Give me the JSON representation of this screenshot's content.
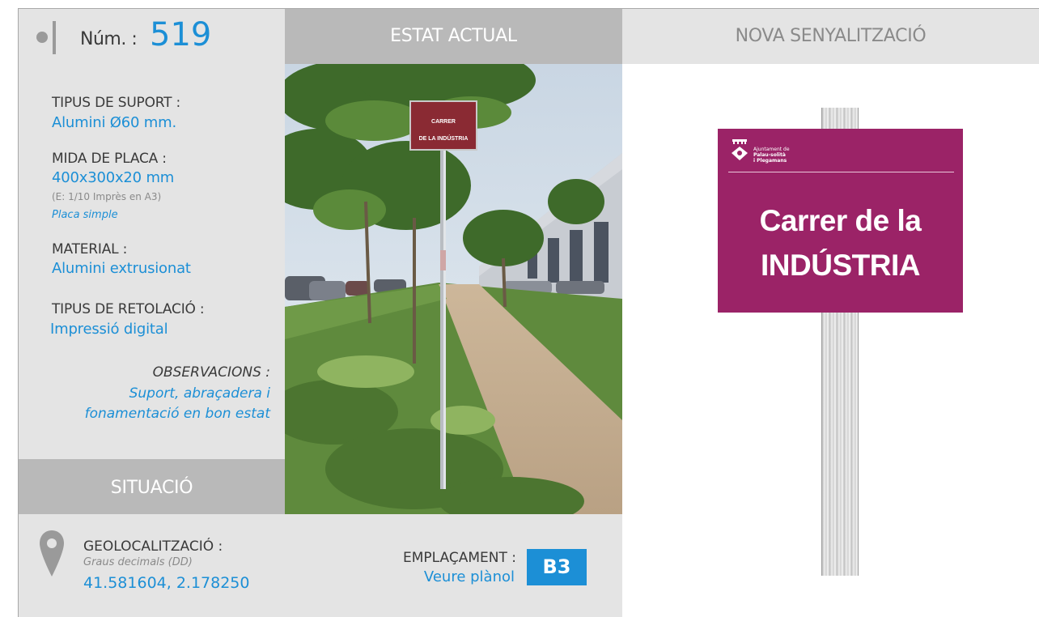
{
  "header": {
    "num_label": "Núm. :",
    "num_value": "519",
    "estat_actual": "ESTAT ACTUAL",
    "nova_senyalitzacio": "NOVA SENYALITZACIÓ"
  },
  "info": {
    "tipus_suport_label": "TIPUS DE SUPORT :",
    "tipus_suport_value": "Alumini Ø60 mm.",
    "mida_placa_label": "MIDA DE PLACA :",
    "mida_placa_value": "400x300x20 mm",
    "mida_placa_escala": "(E: 1/10 Imprès en A3)",
    "mida_placa_tipus": "Placa simple",
    "material_label": "MATERIAL :",
    "material_value": "Alumini extrusionat",
    "retolacio_label": "TIPUS DE RETOLACIÓ :",
    "retolacio_value": "Impressió digital",
    "observacions_label": "OBSERVACIONS :",
    "observacions_line1": "Suport, abraçadera i",
    "observacions_line2": "fonamentació en bon estat"
  },
  "situacio": {
    "title": "SITUACIÓ",
    "geo_label": "GEOLOCALITZACIÓ :",
    "geo_format": "Graus decimals (DD)",
    "geo_value": "41.581604, 2.178250",
    "emplacament_label": "EMPLAÇAMENT :",
    "emplacament_value": "Veure plànol",
    "emplacament_code": "B3"
  },
  "photo_sign": {
    "line1": "CARRER",
    "line2": "DE LA INDÚSTRIA"
  },
  "new_sign": {
    "ajuntament_line1": "Ajuntament de",
    "ajuntament_line2": "Palau-solità",
    "ajuntament_line3": "i Plegamans",
    "title_line1": "Carrer de la",
    "title_line2": "INDÚSTRIA"
  },
  "colors": {
    "accent_blue": "#1c8fd6",
    "panel_grey": "#e4e4e4",
    "header_grey": "#b9b9b9",
    "sign_magenta": "#9b2367"
  }
}
